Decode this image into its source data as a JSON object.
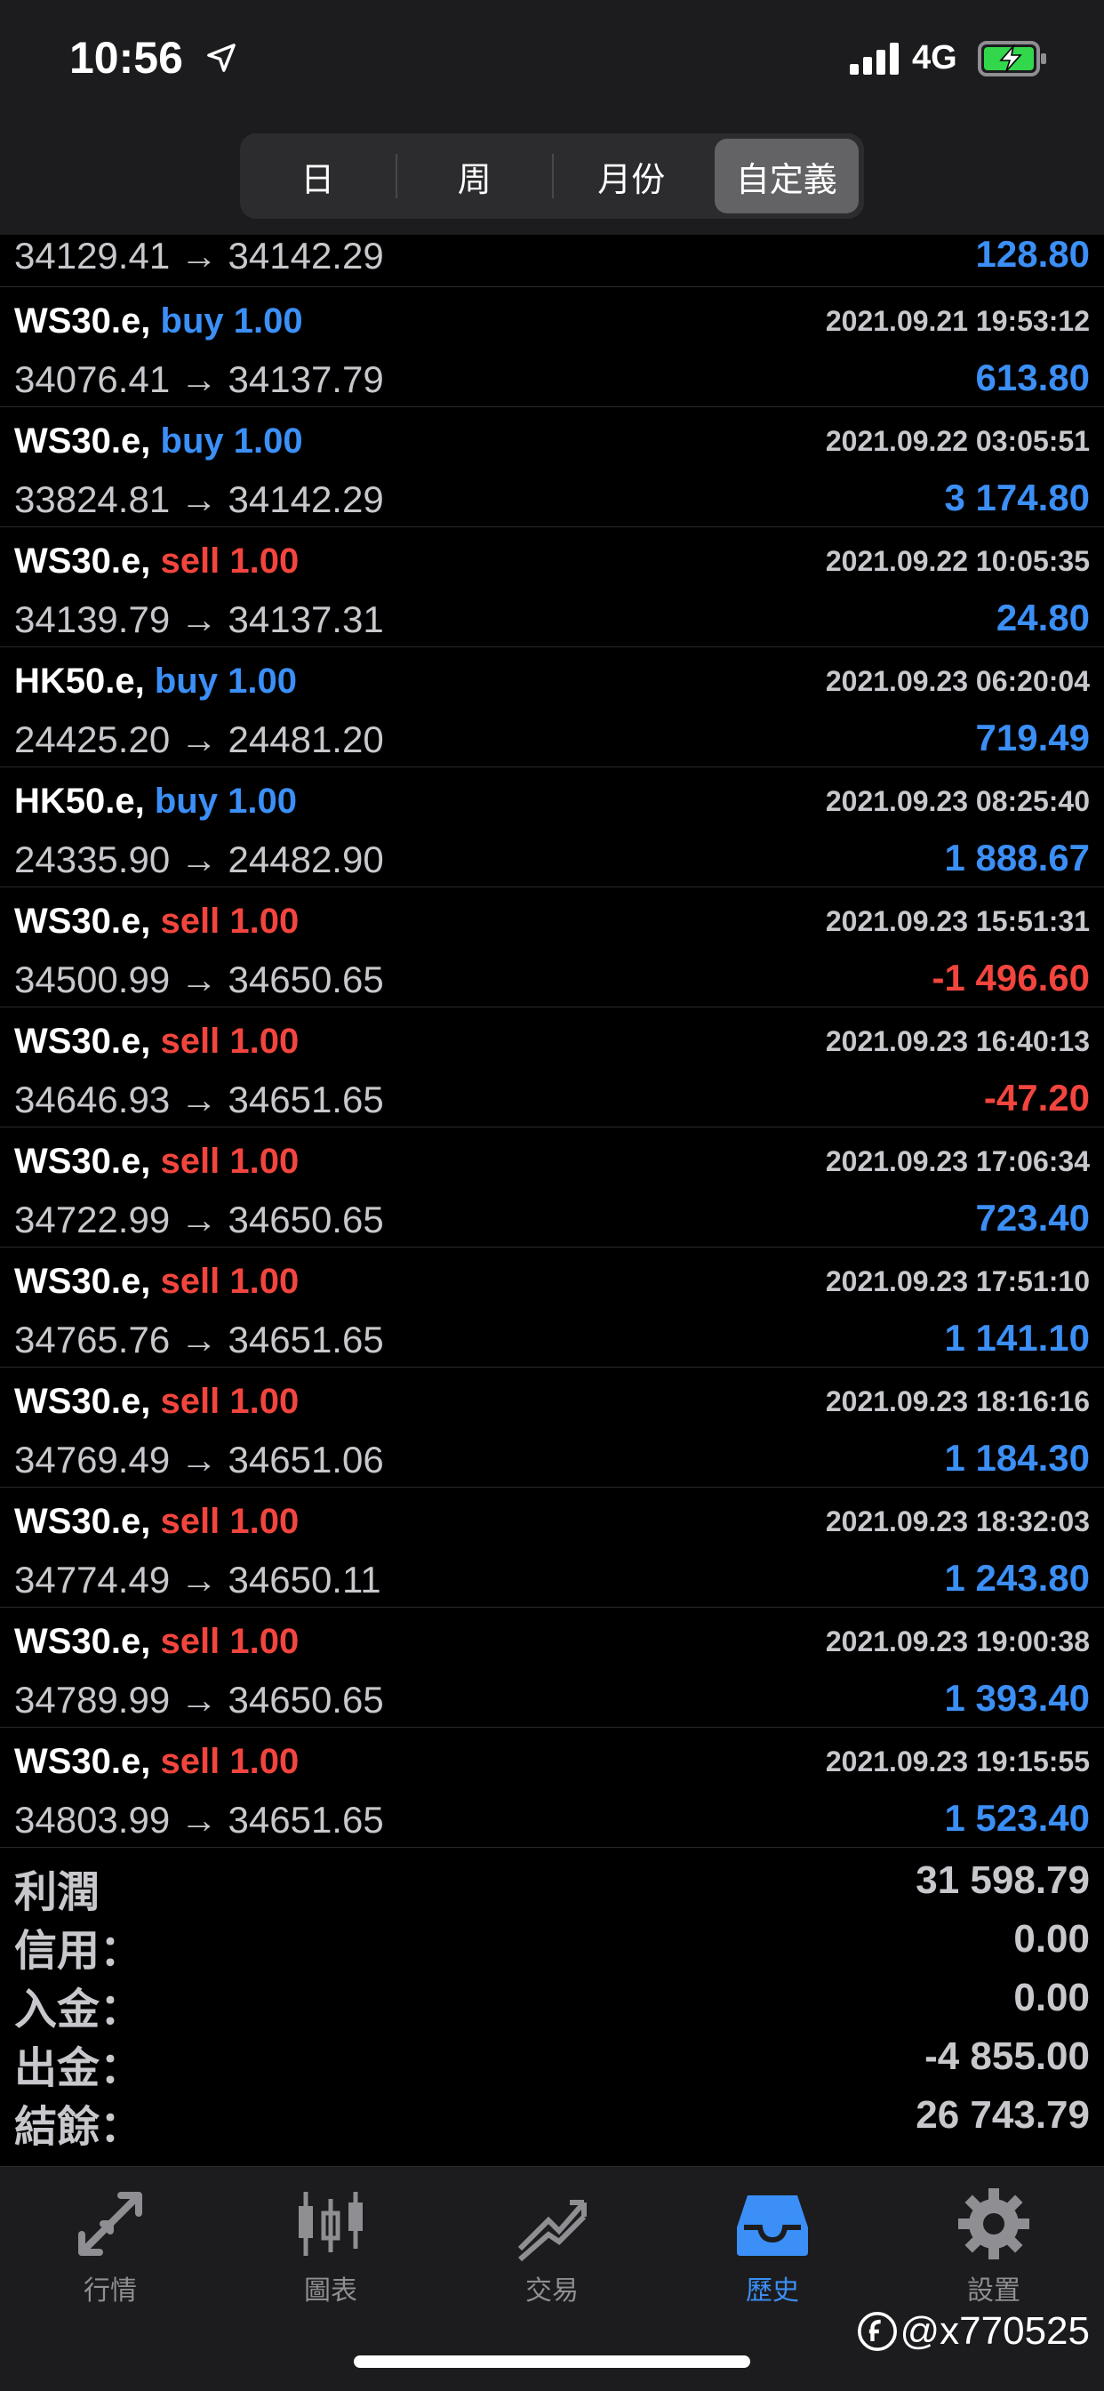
{
  "status_bar": {
    "time": "10:56",
    "network": "4G"
  },
  "segments": [
    {
      "label": "日",
      "active": false
    },
    {
      "label": "周",
      "active": false
    },
    {
      "label": "月份",
      "active": false
    },
    {
      "label": "自定義",
      "active": true
    }
  ],
  "partial_row": {
    "prices": "34129.41 → 34142.29",
    "profit": "128.80"
  },
  "trades": [
    {
      "symbol": "WS30.e,",
      "side": "buy",
      "volume": "1.00",
      "time": "2021.09.21 19:53:12",
      "prices": "34076.41 → 34137.79",
      "profit": "613.80",
      "profit_sign": "pos"
    },
    {
      "symbol": "WS30.e,",
      "side": "buy",
      "volume": "1.00",
      "time": "2021.09.22 03:05:51",
      "prices": "33824.81 → 34142.29",
      "profit": "3 174.80",
      "profit_sign": "pos"
    },
    {
      "symbol": "WS30.e,",
      "side": "sell",
      "volume": "1.00",
      "time": "2021.09.22 10:05:35",
      "prices": "34139.79 → 34137.31",
      "profit": "24.80",
      "profit_sign": "pos"
    },
    {
      "symbol": "HK50.e,",
      "side": "buy",
      "volume": "1.00",
      "time": "2021.09.23 06:20:04",
      "prices": "24425.20 → 24481.20",
      "profit": "719.49",
      "profit_sign": "pos"
    },
    {
      "symbol": "HK50.e,",
      "side": "buy",
      "volume": "1.00",
      "time": "2021.09.23 08:25:40",
      "prices": "24335.90 → 24482.90",
      "profit": "1 888.67",
      "profit_sign": "pos"
    },
    {
      "symbol": "WS30.e,",
      "side": "sell",
      "volume": "1.00",
      "time": "2021.09.23 15:51:31",
      "prices": "34500.99 → 34650.65",
      "profit": "-1 496.60",
      "profit_sign": "neg"
    },
    {
      "symbol": "WS30.e,",
      "side": "sell",
      "volume": "1.00",
      "time": "2021.09.23 16:40:13",
      "prices": "34646.93 → 34651.65",
      "profit": "-47.20",
      "profit_sign": "neg"
    },
    {
      "symbol": "WS30.e,",
      "side": "sell",
      "volume": "1.00",
      "time": "2021.09.23 17:06:34",
      "prices": "34722.99 → 34650.65",
      "profit": "723.40",
      "profit_sign": "pos"
    },
    {
      "symbol": "WS30.e,",
      "side": "sell",
      "volume": "1.00",
      "time": "2021.09.23 17:51:10",
      "prices": "34765.76 → 34651.65",
      "profit": "1 141.10",
      "profit_sign": "pos"
    },
    {
      "symbol": "WS30.e,",
      "side": "sell",
      "volume": "1.00",
      "time": "2021.09.23 18:16:16",
      "prices": "34769.49 → 34651.06",
      "profit": "1 184.30",
      "profit_sign": "pos"
    },
    {
      "symbol": "WS30.e,",
      "side": "sell",
      "volume": "1.00",
      "time": "2021.09.23 18:32:03",
      "prices": "34774.49 → 34650.11",
      "profit": "1 243.80",
      "profit_sign": "pos"
    },
    {
      "symbol": "WS30.e,",
      "side": "sell",
      "volume": "1.00",
      "time": "2021.09.23 19:00:38",
      "prices": "34789.99 → 34650.65",
      "profit": "1 393.40",
      "profit_sign": "pos"
    },
    {
      "symbol": "WS30.e,",
      "side": "sell",
      "volume": "1.00",
      "time": "2021.09.23 19:15:55",
      "prices": "34803.99 → 34651.65",
      "profit": "1 523.40",
      "profit_sign": "pos"
    }
  ],
  "summary": [
    {
      "label": "利潤",
      "value": "31 598.79"
    },
    {
      "label": "信用：",
      "value": "0.00"
    },
    {
      "label": "入金：",
      "value": "0.00"
    },
    {
      "label": "出金：",
      "value": "-4 855.00"
    },
    {
      "label": "結餘：",
      "value": "26 743.79"
    }
  ],
  "tabs": [
    {
      "label": "行情",
      "icon": "quotes-icon",
      "active": false
    },
    {
      "label": "圖表",
      "icon": "chart-icon",
      "active": false
    },
    {
      "label": "交易",
      "icon": "trade-icon",
      "active": false
    },
    {
      "label": "歷史",
      "icon": "history-icon",
      "active": true
    },
    {
      "label": "設置",
      "icon": "settings-icon",
      "active": false
    }
  ],
  "watermark": "@x770525",
  "colors": {
    "buy": "#3b8ff6",
    "sell": "#f2453d",
    "active_tab": "#3b8ff6",
    "inactive_tab": "#8e8e93"
  }
}
